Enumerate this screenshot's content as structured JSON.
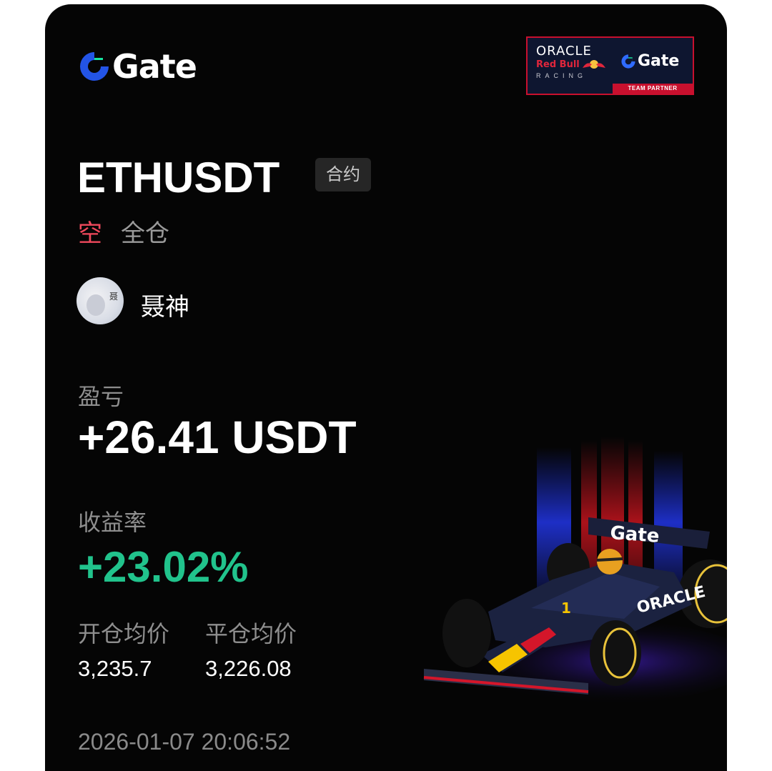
{
  "brand": {
    "name": "Gate"
  },
  "partner_badge": {
    "oracle": "ORACLE",
    "redbull": "Red Bull",
    "racing": "RACING",
    "gate": "Gate",
    "team_partner": "TEAM PARTNER"
  },
  "position": {
    "symbol": "ETHUSDT",
    "type_tag": "合约",
    "side": "空",
    "margin_mode": "全仓"
  },
  "user": {
    "name": "聂神",
    "avatar_mark": "聂"
  },
  "pnl": {
    "label": "盈亏",
    "value": "+26.41 USDT"
  },
  "roi": {
    "label": "收益率",
    "value": "+23.02%"
  },
  "prices": {
    "open_label": "开仓均价",
    "open_value": "3,235.7",
    "close_label": "平仓均价",
    "close_value": "3,226.08"
  },
  "timestamp": "2026-01-07 20:06:52",
  "car": {
    "wing_text": "Gate",
    "sidepod_text": "ORACLE",
    "number": "1"
  },
  "colors": {
    "background": "#050505",
    "short_red": "#f0495c",
    "profit_green": "#21c38c",
    "gate_blue": "#2354e6",
    "gate_cyan": "#17e6a1",
    "label_grey": "#8e8e8e"
  }
}
